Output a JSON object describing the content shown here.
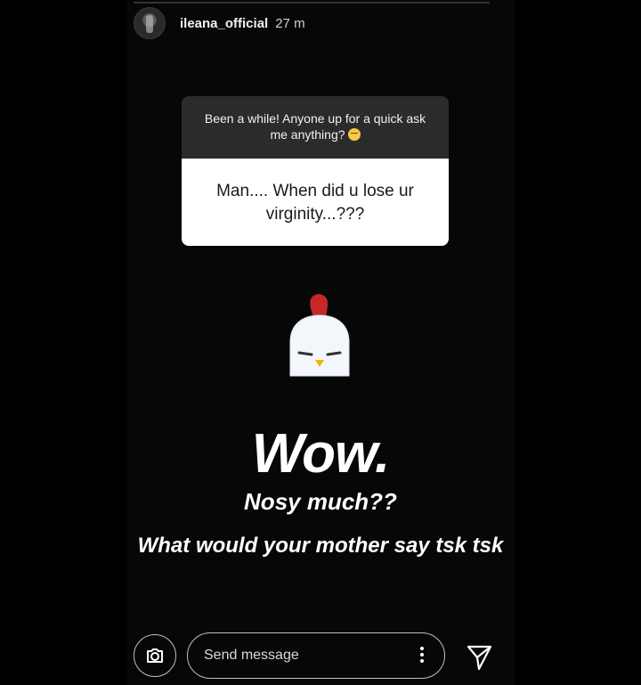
{
  "header": {
    "username": "ileana_official",
    "timestamp": "27 m"
  },
  "question_sticker": {
    "prompt": "Been a while! Anyone up for a quick ask me anything?",
    "prompt_emoji": "relieved-face-icon",
    "response": "Man.... When did u lose ur virginity...???"
  },
  "sticker": {
    "icon": "chicken-icon"
  },
  "overlay_text": {
    "headline": "Wow.",
    "line1": "Nosy much??",
    "line2": "What would your mother say tsk tsk"
  },
  "reply_bar": {
    "placeholder": "Send message",
    "camera_icon": "camera-icon",
    "more_icon": "more-vertical-icon",
    "send_icon": "send-icon"
  },
  "colors": {
    "background": "#000000",
    "question_header_bg": "#2b2b2b",
    "question_body_bg": "#ffffff",
    "chicken_comb": "#c62828",
    "chicken_beak": "#f5b400"
  }
}
